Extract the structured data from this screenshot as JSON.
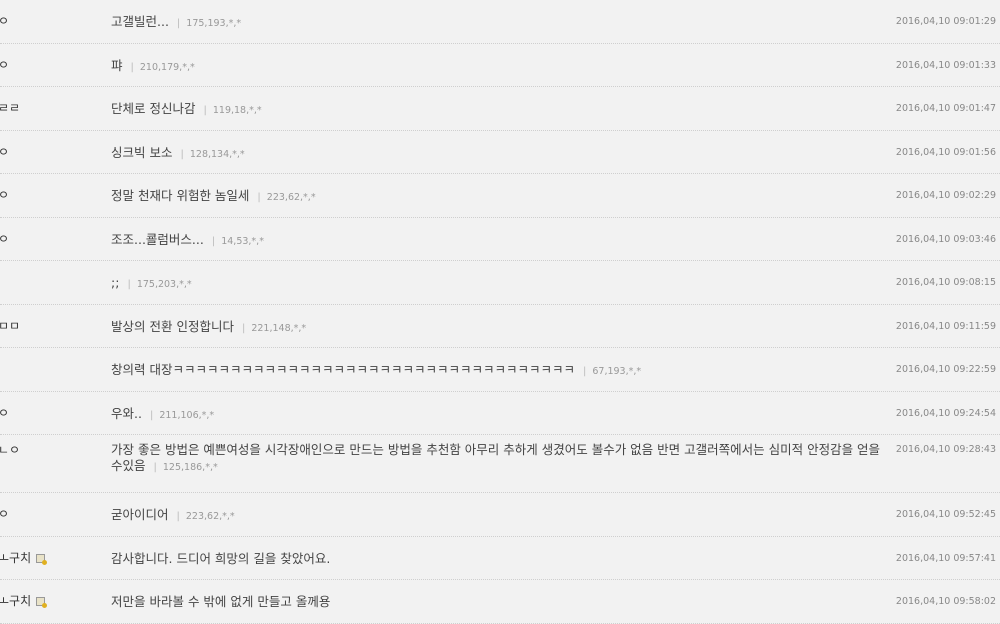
{
  "comments": [
    {
      "nick": "ㅇ",
      "text": "고갤빌런...",
      "ip": "175,193,*,*",
      "date": "2016,04,10 09:01:29",
      "mark": false
    },
    {
      "nick": "ㅇ",
      "text": "퍄",
      "ip": "210,179,*,*",
      "date": "2016,04,10 09:01:33",
      "mark": false
    },
    {
      "nick": "ㄹㄹ",
      "text": "단체로 정신나감",
      "ip": "119,18,*,*",
      "date": "2016,04,10 09:01:47",
      "mark": false
    },
    {
      "nick": "ㅇ",
      "text": "싱크빅 보소",
      "ip": "128,134,*,*",
      "date": "2016,04,10 09:01:56",
      "mark": false
    },
    {
      "nick": "ㅇ",
      "text": "정말 천재다 위험한 놈일세",
      "ip": "223,62,*,*",
      "date": "2016,04,10 09:02:29",
      "mark": false
    },
    {
      "nick": "ㅇ",
      "text": "조조...쿌럼버스...",
      "ip": "14,53,*,*",
      "date": "2016,04,10 09:03:46",
      "mark": false
    },
    {
      "nick": "",
      "text": ";;",
      "ip": "175,203,*,*",
      "date": "2016,04,10 09:08:15",
      "mark": false
    },
    {
      "nick": "ㅁㅁ",
      "text": "발상의 전환 인정합니다",
      "ip": "221,148,*,*",
      "date": "2016,04,10 09:11:59",
      "mark": false
    },
    {
      "nick": "",
      "text": "창의력 대장ㅋㅋㅋㅋㅋㅋㅋㅋㅋㅋㅋㅋㅋㅋㅋㅋㅋㅋㅋㅋㅋㅋㅋㅋㅋㅋㅋㅋㅋㅋㅋㅋㅋㅋㅋ",
      "ip": "67,193,*,*",
      "date": "2016,04,10 09:22:59",
      "mark": false
    },
    {
      "nick": "ㅇ",
      "text": "우와..",
      "ip": "211,106,*,*",
      "date": "2016,04,10 09:24:54",
      "mark": false
    },
    {
      "nick": "ㄴㅇ",
      "text": "가장 좋은 방법은 예쁜여성을 시각장애인으로 만드는 방법을 추천함 아무리 추하게 생겼어도 볼수가 없음 반면 고갤러쪽에서는 심미적 안정감을 얻을수있음",
      "ip": "125,186,*,*",
      "date": "2016,04,10 09:28:43",
      "mark": false,
      "tall": true
    },
    {
      "nick": "ㅇ",
      "text": "굳아이디어",
      "ip": "223,62,*,*",
      "date": "2016,04,10 09:52:45",
      "mark": false
    },
    {
      "nick": "ㅗ구치",
      "text": "감사합니다. 드디어 희망의 길을 찾았어요.",
      "ip": "",
      "date": "2016,04,10 09:57:41",
      "mark": true
    },
    {
      "nick": "ㅗ구치",
      "text": "저만을 바라볼 수 밖에 없게 만들고 올께용",
      "ip": "",
      "date": "2016,04,10 09:58:02",
      "mark": true
    }
  ],
  "separator": "|"
}
